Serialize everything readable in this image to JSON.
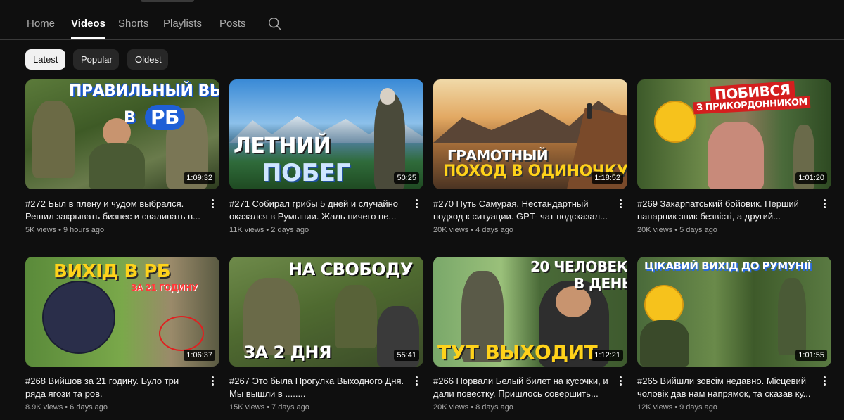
{
  "tabs": [
    {
      "label": "Home"
    },
    {
      "label": "Videos"
    },
    {
      "label": "Shorts"
    },
    {
      "label": "Playlists"
    },
    {
      "label": "Posts"
    }
  ],
  "active_tab": "Videos",
  "icons": {
    "search": "search-icon",
    "menu": "more-vert-icon"
  },
  "chips": [
    {
      "label": "Latest"
    },
    {
      "label": "Popular"
    },
    {
      "label": "Oldest"
    }
  ],
  "videos": [
    {
      "title": "#272 Был в плену и чудом выбрался. Решил закрывать бизнес и сваливать в...",
      "views": "5K views",
      "age": "9 hours ago",
      "duration": "1:09:32",
      "overlay": [
        "ПРАВИЛЬНЫЙ ВЫХОД",
        "В",
        "РБ"
      ]
    },
    {
      "title": "#271 Собирал грибы 5 дней и случайно оказался в Румынии. Жаль ничего не...",
      "views": "11K views",
      "age": "2 days ago",
      "duration": "50:25",
      "overlay": [
        "ЛЕТНИЙ",
        "ПОБЕГ"
      ]
    },
    {
      "title": "#270 Путь Самурая. Нестандартный подход к ситуации. GPT- чат подсказал...",
      "views": "20K views",
      "age": "4 days ago",
      "duration": "1:18:52",
      "overlay": [
        "ГРАМОТНЫЙ",
        "ПОХОД В ОДИНОЧКУ"
      ]
    },
    {
      "title": "#269 Закарпатський бойовик. Перший напарник зник безвісті, а другий...",
      "views": "20K views",
      "age": "5 days ago",
      "duration": "1:01:20",
      "overlay": [
        "ПОБИВСЯ",
        "З ПРИКОРДОННИКОМ"
      ]
    },
    {
      "title": "#268 Вийшов за 21 годину. Було три ряда ягози та ров.",
      "views": "8.9K views",
      "age": "6 days ago",
      "duration": "1:06:37",
      "overlay": [
        "ВИХІД В РБ",
        "ЗА 21 ГОДИНУ"
      ]
    },
    {
      "title": "#267 Это была Прогулка Выходного Дня. Мы вышли в ........",
      "views": "15K views",
      "age": "7 days ago",
      "duration": "55:41",
      "overlay": [
        "НА СВОБОДУ",
        "ЗА 2 ДНЯ"
      ]
    },
    {
      "title": "#266 Порвали Белый билет на кусочки, и дали повестку. Пришлось совершить...",
      "views": "20K views",
      "age": "8 days ago",
      "duration": "1:12:21",
      "overlay": [
        "20 ЧЕЛОВЕК",
        "В ДЕНЬ",
        "ТУТ ВЫХОДИТ"
      ]
    },
    {
      "title": "#265 Вийшли зовсім недавно. Місцевий чоловік дав нам напрямок, та сказав ку...",
      "views": "12K views",
      "age": "9 days ago",
      "duration": "1:01:55",
      "overlay": [
        "ЦІКАВИЙ ВИХІД ДО РУМУНІЇ"
      ]
    }
  ]
}
